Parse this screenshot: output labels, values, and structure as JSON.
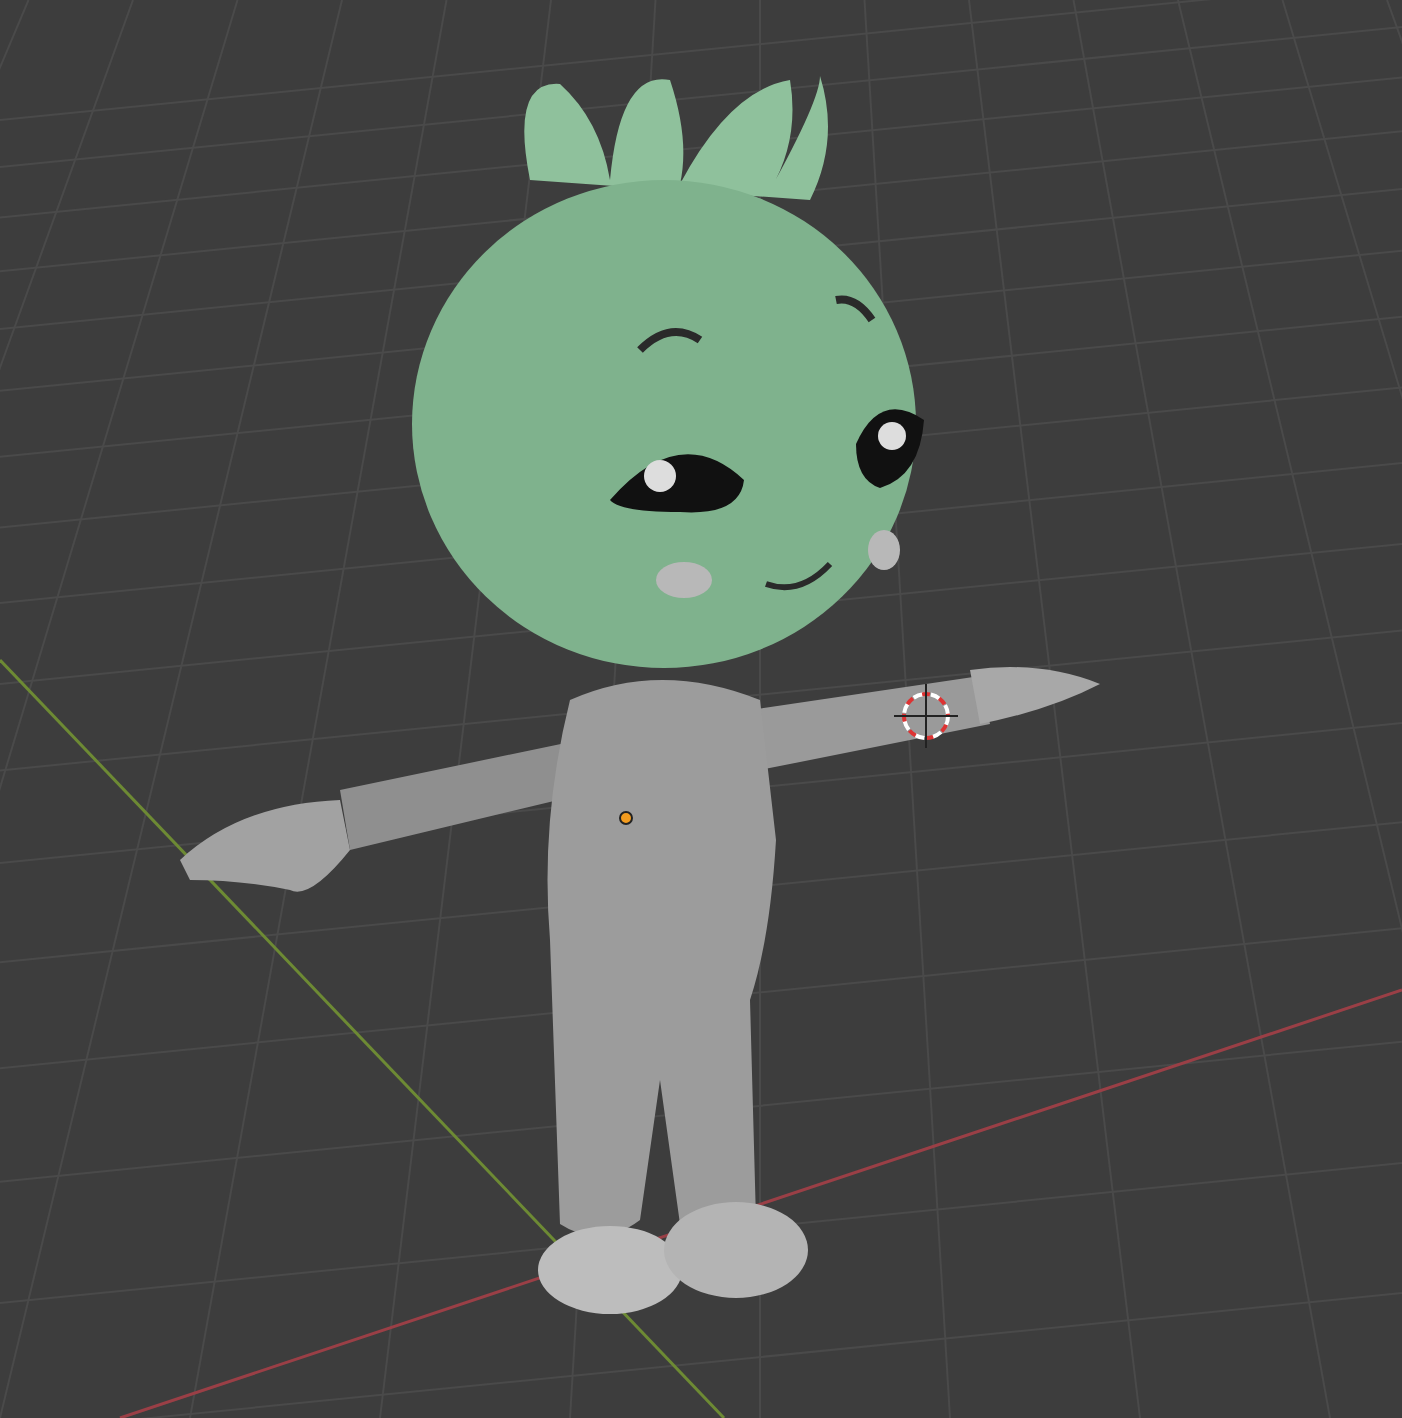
{
  "viewport": {
    "grid": true,
    "axis_lines": true,
    "cursor": true,
    "origin": true
  }
}
